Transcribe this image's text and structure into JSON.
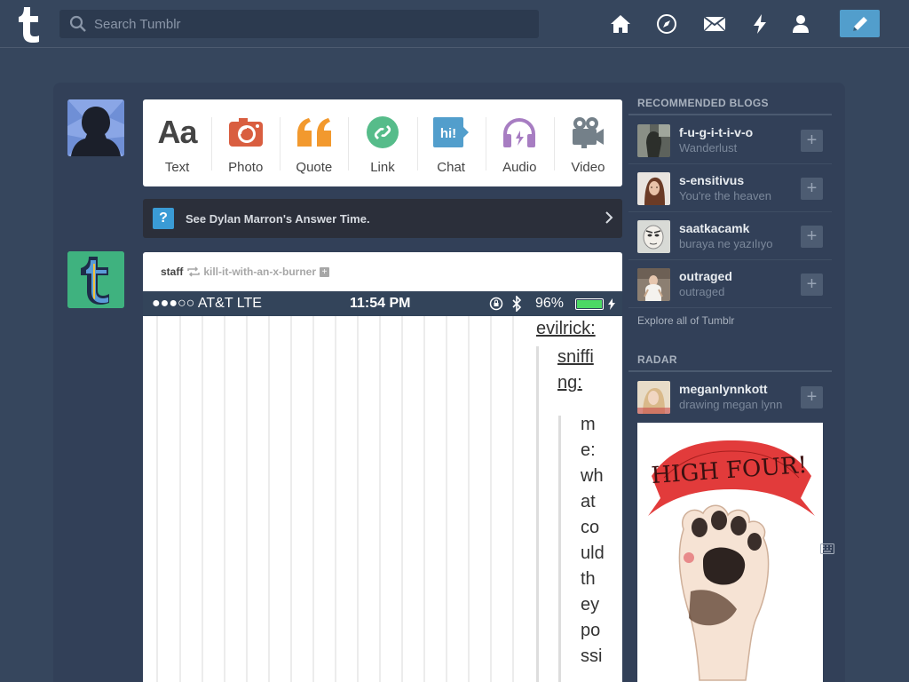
{
  "header": {
    "search_placeholder": "Search Tumblr",
    "nav_icons": [
      "home-icon",
      "explore-compass-icon",
      "inbox-mail-icon",
      "activity-lightning-icon",
      "account-person-icon"
    ],
    "compose_icon": "pencil-icon"
  },
  "post_types": [
    {
      "label": "Text",
      "icon": "text-aa-icon",
      "color": "#444444"
    },
    {
      "label": "Photo",
      "icon": "camera-icon",
      "color": "#d95e40"
    },
    {
      "label": "Quote",
      "icon": "quote-icon",
      "color": "#f2992e"
    },
    {
      "label": "Link",
      "icon": "link-icon",
      "color": "#56bc8a"
    },
    {
      "label": "Chat",
      "icon": "chat-icon",
      "color": "#529ecc"
    },
    {
      "label": "Audio",
      "icon": "headphones-icon",
      "color": "#a77dc2"
    },
    {
      "label": "Video",
      "icon": "video-camera-icon",
      "color": "#748089"
    }
  ],
  "answer_time": {
    "text": "See Dylan Marron's Answer Time."
  },
  "post": {
    "user": "staff",
    "reblogged_from": "kill-it-with-an-x-burner",
    "status_bar": {
      "carrier": "●●●○○ AT&T  LTE",
      "time": "11:54 PM",
      "battery": "96%"
    },
    "content": {
      "name1": "evilrick:",
      "name2_lines": [
        "sniffi",
        "ng:"
      ],
      "text_lines": [
        "m",
        "e:",
        "wh",
        "at",
        "co",
        "uld",
        "th",
        "ey",
        "po",
        "ssi"
      ]
    }
  },
  "sidebar": {
    "recommended_title": "RECOMMENDED BLOGS",
    "recommended": [
      {
        "name": "f-u-g-i-t-i-v-o",
        "subtitle": "Wanderlust"
      },
      {
        "name": "s-ensitivus",
        "subtitle": "You're the heaven"
      },
      {
        "name": "saatkacamk",
        "subtitle": "buraya ne yazılıyo"
      },
      {
        "name": "outraged",
        "subtitle": "outraged"
      }
    ],
    "explore_link": "Explore all of Tumblr",
    "radar_title": "RADAR",
    "radar": {
      "name": "meganlynnkott",
      "subtitle": "drawing megan lynn"
    },
    "radar_image_text": "HIGH FOUR!"
  },
  "colors": {
    "background": "#36465d",
    "accent": "#529ecc",
    "panel": "#324058"
  }
}
